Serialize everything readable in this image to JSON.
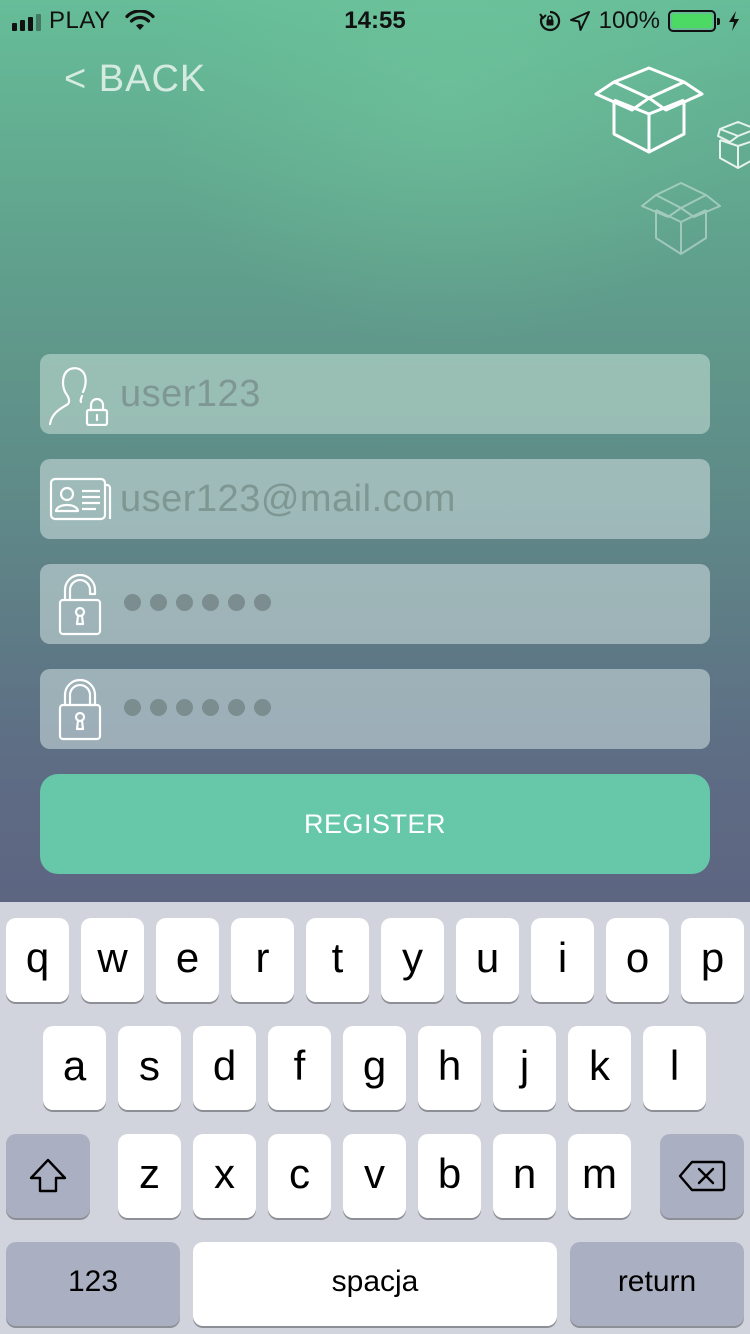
{
  "status_bar": {
    "carrier": "PLAY",
    "time": "14:55",
    "battery": "100%",
    "battery_level": 1.0
  },
  "nav": {
    "back_label": "< BACK"
  },
  "form": {
    "username": {
      "value": "user123",
      "icon": "user-lock-icon"
    },
    "email": {
      "value": "user123@mail.com",
      "icon": "id-card-icon"
    },
    "password": {
      "masked_length": 6,
      "icon": "lock-open-icon"
    },
    "confirm_password": {
      "masked_length": 6,
      "icon": "lock-icon"
    },
    "register_label": "REGISTER"
  },
  "keyboard": {
    "row1": [
      "q",
      "w",
      "e",
      "r",
      "t",
      "y",
      "u",
      "i",
      "o",
      "p"
    ],
    "row2": [
      "a",
      "s",
      "d",
      "f",
      "g",
      "h",
      "j",
      "k",
      "l"
    ],
    "row3": [
      "z",
      "x",
      "c",
      "v",
      "b",
      "n",
      "m"
    ],
    "numbers_label": "123",
    "space_label": "spacja",
    "return_label": "return"
  },
  "colors": {
    "accent": "#66c8a9",
    "battery": "#4cd964"
  }
}
